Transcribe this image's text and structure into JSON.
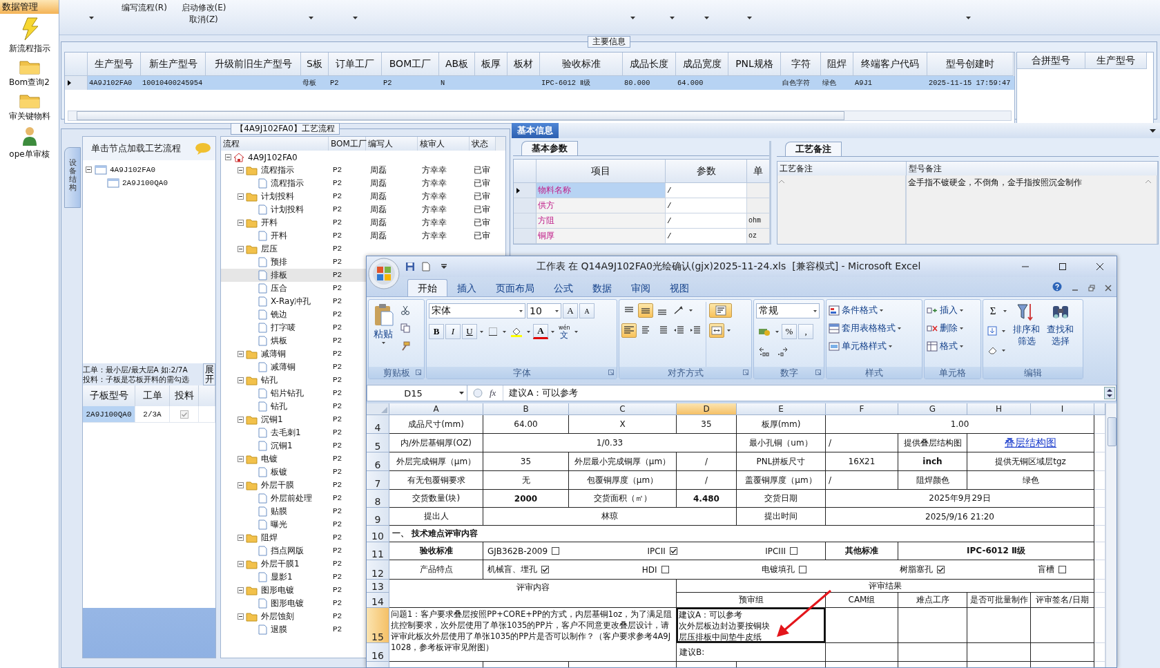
{
  "sidebar": {
    "title": "数据管理",
    "items": [
      {
        "label": "新流程指示",
        "kind": "bolt"
      },
      {
        "label": "Bom查询2",
        "kind": "folder"
      },
      {
        "label": "审关键物料",
        "kind": "folder"
      },
      {
        "label": "ope单审核",
        "kind": "person"
      }
    ]
  },
  "toolbar": {
    "items": [
      {
        "dropdown": true
      },
      {
        "label": "编写流程(R)",
        "dropdown": false
      },
      {
        "label": "启动修改(E) 取消(Z)",
        "dropdown": false
      },
      {
        "dropdown": true
      },
      {
        "dropdown": true
      },
      {
        "dropdown": true
      },
      {
        "dropdown": true
      },
      {
        "dropdown": true
      },
      {
        "dropdown": true
      },
      {
        "dropdown": true
      }
    ]
  },
  "main_info": {
    "title": "主要信息",
    "columns": [
      "生产型号",
      "新生产型号",
      "升级前旧生产型号",
      "S板",
      "订单工厂",
      "BOM工厂",
      "AB板",
      "板厚",
      "板材",
      "验收标准",
      "成品长度",
      "成品宽度",
      "PNL规格",
      "字符",
      "阻焊",
      "终端客户代码",
      "型号创建时"
    ],
    "rows": [
      {
        "selected": true,
        "cells": [
          "4A9J102FA0",
          "10010400245954",
          null,
          "母板",
          "P2",
          "P2",
          "N",
          null,
          null,
          "IPC-6012 Ⅱ级",
          "80.000",
          "64.000",
          null,
          "白色字符",
          "绿色",
          "A9J1",
          "2025-11-15 17:59:47"
        ]
      }
    ],
    "side_columns": [
      "合拼型号",
      "生产型号"
    ]
  },
  "process": {
    "title": "【4A9J102FA0】工艺流程",
    "side_tab": "设备结构",
    "hint": "单击节点加载工艺流程",
    "model_tree": [
      {
        "label": "4A9J102FA0",
        "expanded": true,
        "children": [
          {
            "label": "2A9J100QA0"
          }
        ]
      }
    ],
    "notes": [
      "工单：最小层/最大层A 如:2/7A",
      "投料：子板是芯板开料的需勾选"
    ],
    "expand_button": "展开",
    "sub_columns": [
      "子板型号",
      "工单",
      "投料"
    ],
    "sub_rows": [
      {
        "model": "2A9J100QA0",
        "order": "2/3A",
        "checked": true,
        "selected": true
      }
    ],
    "flow_columns": [
      "流程",
      "BOM工厂",
      "编写人",
      "核审人",
      "状态"
    ],
    "flow": [
      {
        "label": "4A9J102FA0",
        "kind": "root",
        "expanded": true,
        "selected": false,
        "children": [
          {
            "label": "流程指示",
            "kind": "folder",
            "expanded": true,
            "factory": "P2",
            "writer": "周磊",
            "reviewer": "方幸幸",
            "status": "已审",
            "selected": false,
            "children": [
              {
                "label": "流程指示",
                "kind": "step",
                "factory": "P2",
                "writer": "周磊",
                "reviewer": "方幸幸",
                "status": "已审",
                "selected": false
              }
            ]
          },
          {
            "label": "计划投料",
            "kind": "folder",
            "expanded": true,
            "factory": "P2",
            "writer": "周磊",
            "reviewer": "方幸幸",
            "status": "已审",
            "selected": false,
            "children": [
              {
                "label": "计划投料",
                "kind": "step",
                "factory": "P2",
                "writer": "周磊",
                "reviewer": "方幸幸",
                "status": "已审",
                "selected": false
              }
            ]
          },
          {
            "label": "开料",
            "kind": "folder",
            "expanded": true,
            "factory": "P2",
            "writer": "周磊",
            "reviewer": "方幸幸",
            "status": "已审",
            "selected": false,
            "children": [
              {
                "label": "开料",
                "kind": "step",
                "factory": "P2",
                "writer": "周磊",
                "reviewer": "方幸幸",
                "status": "已审",
                "selected": false
              }
            ]
          },
          {
            "label": "层压",
            "kind": "folder",
            "expanded": true,
            "factory": "P2",
            "selected": false,
            "children": [
              {
                "label": "预排",
                "kind": "step",
                "factory": "P2",
                "selected": false
              },
              {
                "label": "排板",
                "kind": "step",
                "factory": "P2",
                "selected": true
              },
              {
                "label": "压合",
                "kind": "step",
                "factory": "P2",
                "selected": false
              },
              {
                "label": "X-Ray冲孔",
                "kind": "step",
                "factory": "P2",
                "selected": false
              },
              {
                "label": "铣边",
                "kind": "step",
                "factory": "P2",
                "selected": false
              },
              {
                "label": "打字唛",
                "kind": "step",
                "factory": "P2",
                "selected": false
              },
              {
                "label": "烘板",
                "kind": "step",
                "factory": "P2",
                "selected": false
              }
            ]
          },
          {
            "label": "减薄铜",
            "kind": "folder",
            "expanded": true,
            "factory": "P2",
            "selected": false,
            "children": [
              {
                "label": "减薄铜",
                "kind": "step",
                "factory": "P2",
                "selected": false
              }
            ]
          },
          {
            "label": "钻孔",
            "kind": "folder",
            "expanded": true,
            "factory": "P2",
            "selected": false,
            "children": [
              {
                "label": "铝片钻孔",
                "kind": "step",
                "factory": "P2",
                "selected": false
              },
              {
                "label": "钻孔",
                "kind": "step",
                "factory": "P2",
                "selected": false
              }
            ]
          },
          {
            "label": "沉铜1",
            "kind": "folder",
            "expanded": true,
            "factory": "P2",
            "selected": false,
            "children": [
              {
                "label": "去毛刺1",
                "kind": "step",
                "factory": "P2",
                "selected": false
              },
              {
                "label": "沉铜1",
                "kind": "step",
                "factory": "P2",
                "selected": false
              }
            ]
          },
          {
            "label": "电镀",
            "kind": "folder",
            "expanded": true,
            "factory": "P2",
            "selected": false,
            "children": [
              {
                "label": "板镀",
                "kind": "step",
                "factory": "P2",
                "selected": false
              }
            ]
          },
          {
            "label": "外层干膜",
            "kind": "folder",
            "expanded": true,
            "factory": "P2",
            "selected": false,
            "children": [
              {
                "label": "外层前处理",
                "kind": "step",
                "factory": "P2",
                "selected": false
              },
              {
                "label": "贴膜",
                "kind": "step",
                "factory": "P2",
                "selected": false
              },
              {
                "label": "曝光",
                "kind": "step",
                "factory": "P2",
                "selected": false
              }
            ]
          },
          {
            "label": "阻焊",
            "kind": "folder",
            "expanded": true,
            "factory": "P2",
            "selected": false,
            "children": [
              {
                "label": "挡点网版",
                "kind": "step",
                "factory": "P2",
                "selected": false
              }
            ]
          },
          {
            "label": "外层干膜1",
            "kind": "folder",
            "expanded": true,
            "factory": "P2",
            "selected": false,
            "children": [
              {
                "label": "显影1",
                "kind": "step",
                "factory": "P2",
                "selected": false
              }
            ]
          },
          {
            "label": "图形电镀",
            "kind": "folder",
            "expanded": true,
            "factory": "P2",
            "selected": false,
            "children": [
              {
                "label": "图形电镀",
                "kind": "step",
                "factory": "P2",
                "selected": false
              }
            ]
          },
          {
            "label": "外层蚀刻",
            "kind": "folder",
            "expanded": true,
            "factory": "P2",
            "selected": false,
            "children": [
              {
                "label": "退膜",
                "kind": "step",
                "factory": "P2",
                "selected": false
              }
            ]
          }
        ]
      }
    ]
  },
  "basic_info": {
    "tab": "基本信息",
    "params": {
      "tab": "基本参数",
      "columns": [
        "项目",
        "参数",
        "单"
      ],
      "rows": [
        {
          "item": "物料名称",
          "value": "/",
          "selected": true
        },
        {
          "item": "供方",
          "value": "/",
          "selected": false
        },
        {
          "item": "方阻",
          "value": "/",
          "unit": "ohm",
          "selected": false
        },
        {
          "item": "铜厚",
          "value": "/",
          "unit": "oz",
          "selected": false
        }
      ]
    },
    "remarks": {
      "tab": "工艺备注",
      "columns": [
        "工艺备注",
        "型号备注"
      ],
      "model_note": "金手指不镀硬金，不倒角，金手指按照沉金制作"
    }
  },
  "excel": {
    "title": "工作表 在 Q14A9J102FA0光绘确认(gjx)2025-11-24.xls  [兼容模式] - Microsoft Excel",
    "tabs": [
      {
        "label": "开始",
        "selected": true
      },
      {
        "label": "插入",
        "selected": false
      },
      {
        "label": "页面布局",
        "selected": false
      },
      {
        "label": "公式",
        "selected": false
      },
      {
        "label": "数据",
        "selected": false
      },
      {
        "label": "审阅",
        "selected": false
      },
      {
        "label": "视图",
        "selected": false
      }
    ],
    "ribbon": {
      "groups": [
        {
          "kind": "clipboard",
          "label": "剪贴板",
          "paste": "粘贴"
        },
        {
          "kind": "font",
          "label": "字体",
          "font": "宋体",
          "size": "10",
          "grow": "A",
          "shrink": "A",
          "bold": "B",
          "italic": "I",
          "underline": "U",
          "font_color": "A",
          "phonetic_top": "wén",
          "phonetic": "文"
        },
        {
          "kind": "alignment",
          "label": "对齐方式",
          "buttons": [
            {
              "selected": false
            },
            {
              "selected": true
            },
            {
              "selected": false
            },
            {
              "selected": false
            },
            {
              "selected": true
            },
            {
              "selected": false
            },
            {
              "selected": false
            },
            {
              "selected": false
            },
            {
              "selected": false
            },
            {
              "selected": true
            },
            {
              "selected": true
            }
          ]
        },
        {
          "kind": "number",
          "label": "数字",
          "format": "常规",
          "percent": "%",
          "comma": ","
        },
        {
          "kind": "styles",
          "label": "样式",
          "items": [
            "条件格式",
            "套用表格格式",
            "单元格样式"
          ]
        },
        {
          "kind": "cells",
          "label": "单元格",
          "items": [
            "插入",
            "删除",
            "格式"
          ]
        },
        {
          "kind": "editing",
          "label": "编辑",
          "sum": "Σ",
          "sort": [
            "排序和",
            "筛选"
          ],
          "find": [
            "查找和",
            "选择"
          ]
        }
      ]
    },
    "name_box": "D15",
    "fx": "fx",
    "formula": "建议A：可以参考",
    "columns": [
      {
        "label": "A",
        "selected": false
      },
      {
        "label": "B",
        "selected": false
      },
      {
        "label": "C",
        "selected": false
      },
      {
        "label": "D",
        "selected": true
      },
      {
        "label": "E",
        "selected": false
      },
      {
        "label": "F",
        "selected": false
      },
      {
        "label": "G",
        "selected": false
      },
      {
        "label": "H",
        "selected": false
      },
      {
        "label": "I",
        "selected": false
      }
    ],
    "rows": [
      {
        "label": "4",
        "selected": false,
        "cells": [
          {
            "text": "成品尺寸(mm)"
          },
          {
            "text": "64.00"
          },
          {
            "text": "X"
          },
          {
            "text": "35"
          },
          {
            "text": "板厚(mm)"
          },
          {
            "text": "1.00"
          },
          null,
          null,
          null
        ]
      },
      {
        "label": "5",
        "selected": false,
        "cells": [
          {
            "text": "内/外层基铜厚(OZ)"
          },
          {
            "text": "1/0.33"
          },
          null,
          null,
          {
            "text": "最小孔铜（um）"
          },
          {
            "text": "/",
            "kind": "left"
          },
          {
            "text": "提供叠层结构图"
          },
          {
            "text": "叠层结构图",
            "kind": "link"
          },
          null
        ]
      },
      {
        "label": "6",
        "selected": false,
        "cells": [
          {
            "text": "外层完成铜厚（μm）"
          },
          {
            "text": "35"
          },
          {
            "text": "外层最小完成铜厚（μm）"
          },
          {
            "text": "/"
          },
          {
            "text": "PNL拼板尺寸"
          },
          {
            "text": "16X21"
          },
          {
            "text": "inch",
            "bold": true
          },
          {
            "text": "提供无铜区域层tgz"
          },
          null
        ]
      },
      {
        "label": "7",
        "selected": false,
        "cells": [
          {
            "text": "有无包覆铜要求"
          },
          {
            "text": "无"
          },
          {
            "text": "包覆铜厚度（μm）"
          },
          {
            "text": "/"
          },
          {
            "text": "盖覆铜厚度（μm）"
          },
          {
            "text": "/",
            "kind": "left"
          },
          {
            "text": "阻焊颜色"
          },
          {
            "text": "绿色"
          },
          null
        ]
      },
      {
        "label": "8",
        "selected": false,
        "cells": [
          {
            "text": "交货数量(块)"
          },
          {
            "text": "2000",
            "bold": true
          },
          {
            "text": "交货面积（㎡）"
          },
          {
            "text": "4.480",
            "bold": true
          },
          {
            "text": "交货日期"
          },
          {
            "text": "2025年9月29日"
          },
          null,
          null,
          null
        ]
      },
      {
        "label": "9",
        "selected": false,
        "cells": [
          {
            "text": "提出人"
          },
          {
            "text": "林琼"
          },
          null,
          null,
          {
            "text": "提出时间"
          },
          {
            "text": "2025/9/16 21:20"
          },
          null,
          null,
          null
        ]
      },
      {
        "label": "10",
        "selected": false,
        "cells": [
          {
            "text": "一、 技术难点评审内容",
            "bold": true,
            "kind": "left"
          },
          null,
          null,
          null,
          null,
          null,
          null,
          null,
          null
        ]
      },
      {
        "label": "11",
        "selected": false,
        "cells": [
          {
            "text": "验收标准",
            "bold": true
          },
          {
            "kind": "options",
            "options": [
              {
                "label": "GJB362B-2009",
                "checked": false
              },
              {
                "label": "IPCII",
                "checked": true
              },
              {
                "label": "IPCIII",
                "checked": false
              }
            ]
          },
          null,
          null,
          null,
          {
            "text": "其他标准",
            "bold": true
          },
          {
            "text": "IPC-6012 Ⅱ级",
            "bold": true
          },
          null,
          null
        ]
      },
      {
        "label": "12",
        "selected": false,
        "cells": [
          {
            "text": "产品特点"
          },
          {
            "kind": "options",
            "options": [
              {
                "label": "机械盲、埋孔",
                "checked": true
              },
              {
                "label": "HDI",
                "checked": false
              },
              {
                "label": "电镀填孔",
                "checked": false
              },
              {
                "label": "树脂塞孔",
                "checked": true
              },
              {
                "label": "盲槽",
                "checked": false
              }
            ]
          },
          null,
          null,
          null,
          null,
          null,
          null,
          null
        ]
      },
      {
        "label": "13",
        "selected": false,
        "cells": [
          {
            "text": "评审内容",
            "kind": "tall"
          },
          null,
          null,
          {
            "text": "评审结果"
          },
          null,
          null,
          null,
          null,
          null
        ]
      },
      {
        "label": "14",
        "selected": false,
        "cells": [
          null,
          null,
          null,
          {
            "text": "预审组"
          },
          null,
          {
            "text": "CAM组"
          },
          {
            "text": "难点工序"
          },
          {
            "text": "是否可批量制作"
          },
          {
            "text": "评审签名/日期"
          }
        ]
      },
      {
        "label": "15",
        "selected": true,
        "cells": [
          {
            "text": "问题1：客户要求叠层按照PP+CORE+PP的方式，内层基铜1oz，为了满足阻抗控制要求，次外层使用了单张1035的PP片，客户不同意更改叠层设计，请评审此板次外层使用了单张1035的PP片是否可以制作？（客户要求参考4A9J1028，参考板评审见附图）",
            "kind": "paragraph"
          },
          null,
          null,
          {
            "lines": [
              "建议A：可以参考",
              "次外层板边封边要按铜块",
              "层压排板中间垫牛皮纸"
            ],
            "selected": true
          },
          null
        ]
      },
      {
        "label": "16",
        "selected": false,
        "cells": [
          null,
          null,
          null,
          {
            "text": "建议B:",
            "kind": "left"
          },
          null
        ]
      }
    ]
  }
}
